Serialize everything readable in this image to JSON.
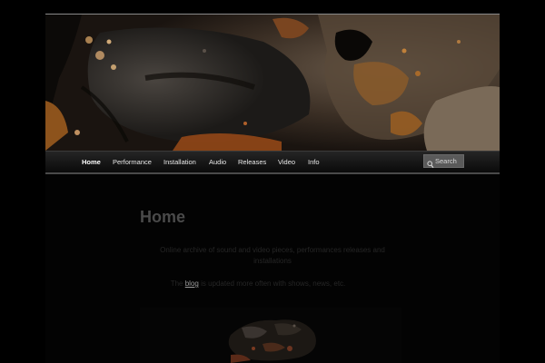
{
  "nav": {
    "items": [
      {
        "label": "Home",
        "active": true
      },
      {
        "label": "Performance"
      },
      {
        "label": "Installation"
      },
      {
        "label": "Audio"
      },
      {
        "label": "Releases"
      },
      {
        "label": "Video"
      },
      {
        "label": "Info"
      }
    ]
  },
  "search": {
    "placeholder": "Search",
    "icon": "search-icon"
  },
  "main": {
    "title": "Home",
    "intro": "Online archive of sound and video pieces, performances releases and installations",
    "blog_prefix": "The ",
    "blog_link": "blog",
    "blog_suffix": " is updated more often with shows, news, etc."
  },
  "colors": {
    "background": "#000000",
    "nav_text": "#e8e8e8",
    "title": "#4a4a4a",
    "body_text": "#262626",
    "rust": "#8b4a1c"
  }
}
